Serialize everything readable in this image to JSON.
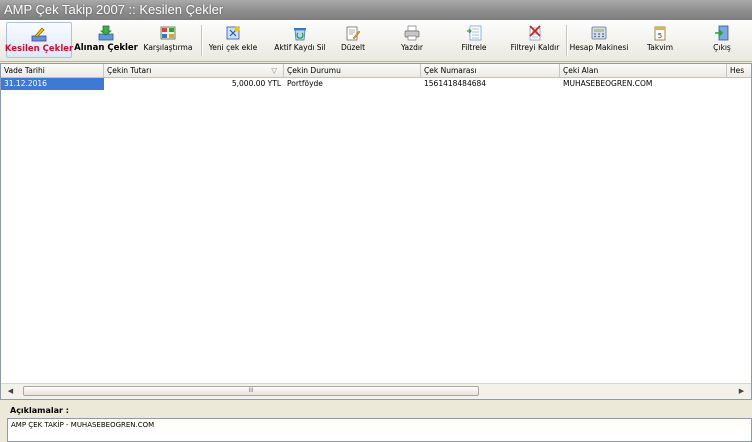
{
  "window": {
    "title": "AMP Çek Takip 2007 :: Kesilen Çekler"
  },
  "toolbar": {
    "buttons": [
      {
        "label": "Kesilen Çekler",
        "icon": "pencil-check-icon"
      },
      {
        "label": "Alınan Çekler",
        "icon": "check-in-tray-icon"
      },
      {
        "label": "Karşılaştırma",
        "icon": "compare-grid-icon"
      },
      {
        "label": "Yeni çek ekle",
        "icon": "new-check-icon"
      },
      {
        "label": "Aktif Kaydı Sil",
        "icon": "recycle-icon"
      },
      {
        "label": "Düzelt",
        "icon": "edit-icon"
      },
      {
        "label": "Yazdır",
        "icon": "printer-icon"
      },
      {
        "label": "Filtrele",
        "icon": "filter-icon"
      },
      {
        "label": "Filtreyi Kaldır",
        "icon": "filter-remove-icon"
      },
      {
        "label": "Hesap Makinesi",
        "icon": "calculator-icon"
      },
      {
        "label": "Takvim",
        "icon": "calendar-icon"
      },
      {
        "label": "Çıkış",
        "icon": "exit-icon"
      }
    ]
  },
  "grid": {
    "columns": [
      "Vade Tarihi",
      "Çekin Tutarı",
      "Çekin Durumu",
      "Çek Numarası",
      "Çeki Alan",
      "Hes"
    ],
    "sort_indicator": "▽",
    "rows": [
      {
        "vade_tarihi": "31.12.2016",
        "tutar": "5,000.00 YTL",
        "durum": "Portföyde",
        "numara": "1561418484684",
        "alan": "MUHASEBEOGREN.COM"
      }
    ],
    "scrollbar_grip": "III"
  },
  "notes": {
    "label": "Açıklamalar :",
    "text": "AMP ÇEK TAKİP - MUHASEBEOGREN.COM"
  },
  "colors": {
    "selection": "#3d79d5",
    "active_label": "#c8102e",
    "titlebar": "#8e8e8e"
  }
}
